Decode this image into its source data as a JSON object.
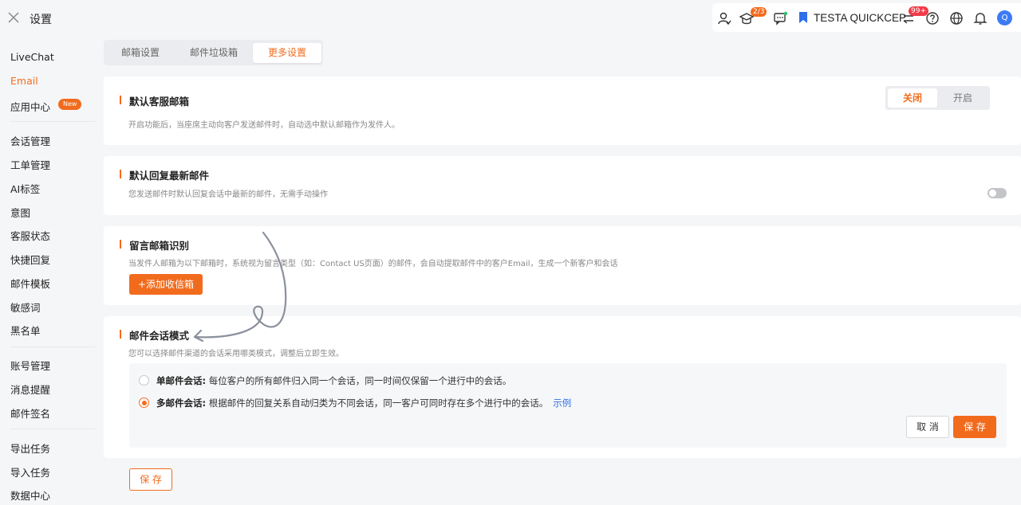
{
  "app": {
    "title": "设置"
  },
  "header": {
    "course_badge": "2/3",
    "team_name": "TESTA QUICKCEP",
    "notify_badge": "99+",
    "avatar_letter": "Q"
  },
  "sidebar": {
    "items": [
      {
        "label": "LiveChat"
      },
      {
        "label": "Email"
      },
      {
        "label": "应用中心"
      },
      {
        "label": "会话管理"
      },
      {
        "label": "工单管理"
      },
      {
        "label": "AI标签"
      },
      {
        "label": "意图"
      },
      {
        "label": "客服状态"
      },
      {
        "label": "快捷回复"
      },
      {
        "label": "邮件模板"
      },
      {
        "label": "敏感词"
      },
      {
        "label": "黑名单"
      },
      {
        "label": "账号管理"
      },
      {
        "label": "消息提醒"
      },
      {
        "label": "邮件签名"
      },
      {
        "label": "导出任务"
      },
      {
        "label": "导入任务"
      },
      {
        "label": "数据中心"
      }
    ],
    "new_badge": "New"
  },
  "tabs": [
    {
      "label": "邮箱设置"
    },
    {
      "label": "邮件垃圾箱"
    },
    {
      "label": "更多设置"
    }
  ],
  "sections": {
    "default_mailbox": {
      "title": "默认客服邮箱",
      "desc": "开启功能后，当座席主动向客户发送邮件时，自动选中默认邮箱作为发件人。",
      "off_label": "关闭",
      "on_label": "开启"
    },
    "reply_latest": {
      "title": "默认回复最新邮件",
      "desc": "您发送邮件时默认回复会话中最新的邮件，无需手动操作"
    },
    "message_box": {
      "title": "留言邮箱识别",
      "desc": "当发件人邮箱为以下邮箱时，系统视为留言类型（如：Contact US页面）的邮件，会自动提取邮件中的客户Email，生成一个新客户和会话",
      "add_button": "+添加收信箱"
    },
    "session_mode": {
      "title": "邮件会话模式",
      "desc": "您可以选择邮件渠道的会话采用哪类模式，调整后立即生效。",
      "single_label": "单邮件会话:",
      "single_text": " 每位客户的所有邮件归入同一个会话，同一时间仅保留一个进行中的会话。",
      "multi_label": "多邮件会话:",
      "multi_text": " 根据邮件的回复关系自动归类为不同会话，同一客户可同时存在多个进行中的会话。",
      "example_link": "示例",
      "cancel_button": "取 消",
      "save_button": "保 存"
    }
  },
  "footer": {
    "save_button": "保 存"
  },
  "colors": {
    "accent": "#f26b1d",
    "link": "#2f6ee8",
    "avatar": "#3b7bf6"
  }
}
